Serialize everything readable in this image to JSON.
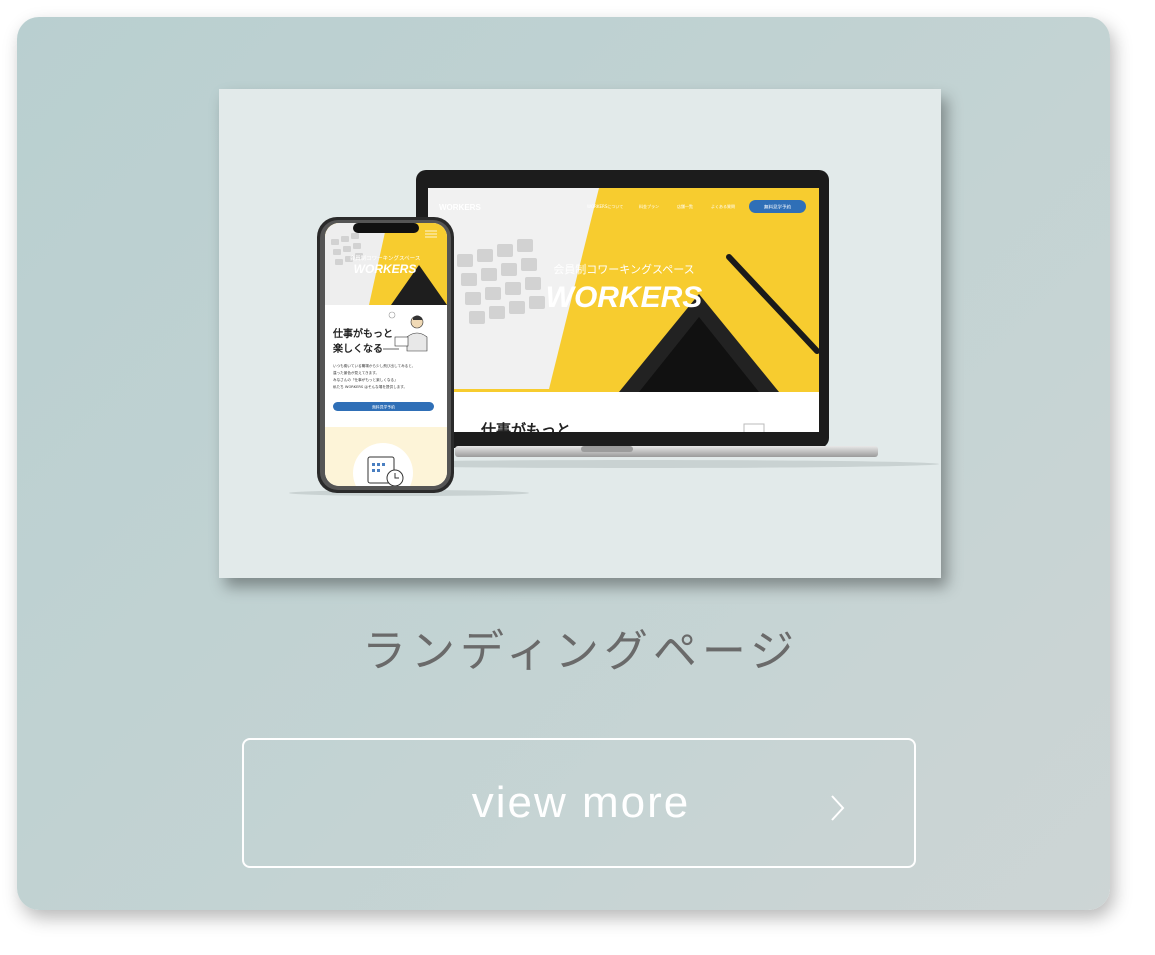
{
  "card": {
    "title": "ランディングページ",
    "button_label": "view more",
    "button_icon": "chevron-right-icon"
  },
  "laptop_screen": {
    "logo": "WORKERS",
    "nav": [
      "WORKERSについて",
      "料金プラン",
      "店舗一覧",
      "よくある質問"
    ],
    "cta": "無料見学予約",
    "hero_sub": "会員制コワーキングスペース",
    "hero_title": "WORKERS",
    "section_heading": "仕事がもっと"
  },
  "phone_screen": {
    "hero_sub": "会員制コワーキングスペース",
    "hero_title": "WORKERS",
    "heading_line1": "仕事がもっと",
    "heading_line2": "楽しくなる",
    "body_lines": [
      "いつも働いている職場から少し飛び出してみると、",
      "違った景色が見えてきます。",
      "みなさんの「仕事がもっと楽しくなる」",
      "私たち WORKERS はそんな場を提供します。"
    ],
    "cta": "無料見学予約"
  },
  "colors": {
    "accent_yellow": "#f7cc2f",
    "cta_blue": "#2f6fb7",
    "title_gray": "#6a6a6a"
  }
}
